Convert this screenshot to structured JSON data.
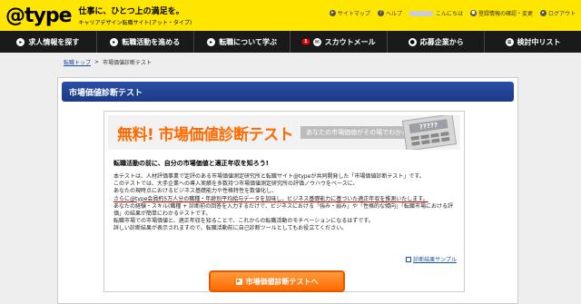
{
  "header": {
    "logo": "@type",
    "tagline1": "仕事に、ひとつ上の満足を。",
    "tagline2": "キャリアデザイン転職サイト(アット・タイプ)",
    "links": [
      {
        "label": "サイトマップ",
        "icon": "sitemap-icon"
      },
      {
        "label": "ヘルプ",
        "icon": "help-icon"
      }
    ],
    "greeting": "こんにちは",
    "account_link": "登録情報の確認・変更",
    "logout": "ログアウト"
  },
  "nav": {
    "items": [
      {
        "label": "求人情報を探す",
        "icon": "search-icon"
      },
      {
        "label": "転職活動を進める",
        "icon": "arrow-icon"
      },
      {
        "label": "転職について学ぶ",
        "icon": "book-icon"
      },
      {
        "label": "スカウトメール",
        "icon": "mail-icon",
        "badge": "1"
      },
      {
        "label": "応募企業から",
        "icon": "people-icon"
      },
      {
        "label": "検討中リスト",
        "icon": "list-icon"
      }
    ]
  },
  "breadcrumb": {
    "home": "転職トップ",
    "separator": ">",
    "current": "市場価値診断テスト"
  },
  "main": {
    "title": "市場価値診断テスト",
    "banner_title": "無料! 市場価値診断テスト",
    "banner_sub": "あなたの市場価値がその場でわかる",
    "calc_screen": "?????",
    "lead": "転職活動の前に、自分の市場価値と適正年収を知ろう!",
    "paragraphs": [
      "本テストは、人材評価事業で定評のある市場価値測定研究所と転職サイト@typeが共同開発した「市場価値診断テスト」です。",
      "このテストでは、大手企業への導入実績を多数持つ市場価値測定研究所の評価ノウハウをベースに、",
      "あなたの現時点におけるビジネス基礎能力や性格特性を数値化し、",
      "さらに@type会員約5万人分の職種・年齢別平均給与データを加味し、ビジネス基礎能力に基づいた適正年収を推測いたします。",
      "あなたの経験・スキル(職種 + 診断前の回答を入力するだけで、ビジネスにおける「強み・弱み」や「性格的な傾向」「転職市場における評価」の結果が簡単にわかるテストです。",
      "転職市場での市場価値と、適正年収を知ることで、これからの転職活動のモチベーションになるはずです。",
      "詳しい診断結果が表示されますので、転職活動前に自己診断ツールとしてもお役立てください。"
    ],
    "sample_link": "診断結果サンプル",
    "cta_label": "市場価値診断テストへ"
  },
  "colors": {
    "header_bg": "#ffe600",
    "nav_bg": "#1a1a1a",
    "title_bar": "#1b3a86",
    "accent": "#ff6a00"
  }
}
